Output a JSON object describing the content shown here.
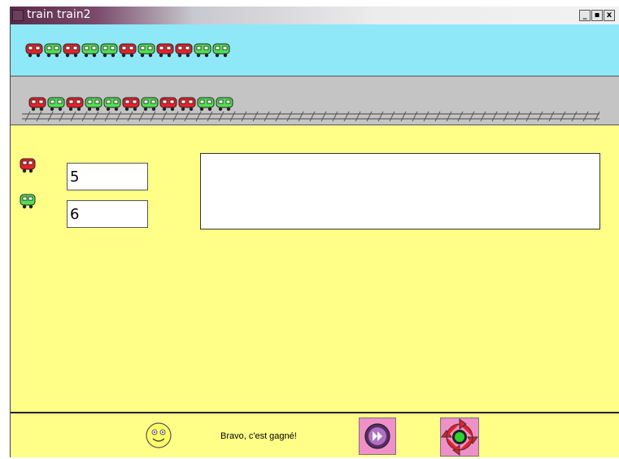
{
  "window": {
    "title": "train train2",
    "controls": [
      "minimize",
      "maximize",
      "close"
    ]
  },
  "top_train": {
    "wagons": [
      "red",
      "green",
      "red",
      "green",
      "green",
      "red",
      "green",
      "red",
      "red",
      "green",
      "green"
    ]
  },
  "track_train": {
    "wagons": [
      "red",
      "green",
      "red",
      "green",
      "green",
      "red",
      "green",
      "red",
      "red",
      "green",
      "green"
    ]
  },
  "legend": {
    "red_wagon_count": "5",
    "green_wagon_count": "6"
  },
  "answer_box": {
    "value": ""
  },
  "status": {
    "message": "Bravo, c'est gagné!"
  },
  "icons": [
    "smiley-icon",
    "next-icon",
    "reload-icon"
  ],
  "colors": {
    "wagon_red": "#e8202a",
    "wagon_green": "#50e050",
    "sky": "#8ee8f8",
    "ground": "#c4c4c4",
    "background": "#ffff88",
    "button": "#f090c8"
  }
}
